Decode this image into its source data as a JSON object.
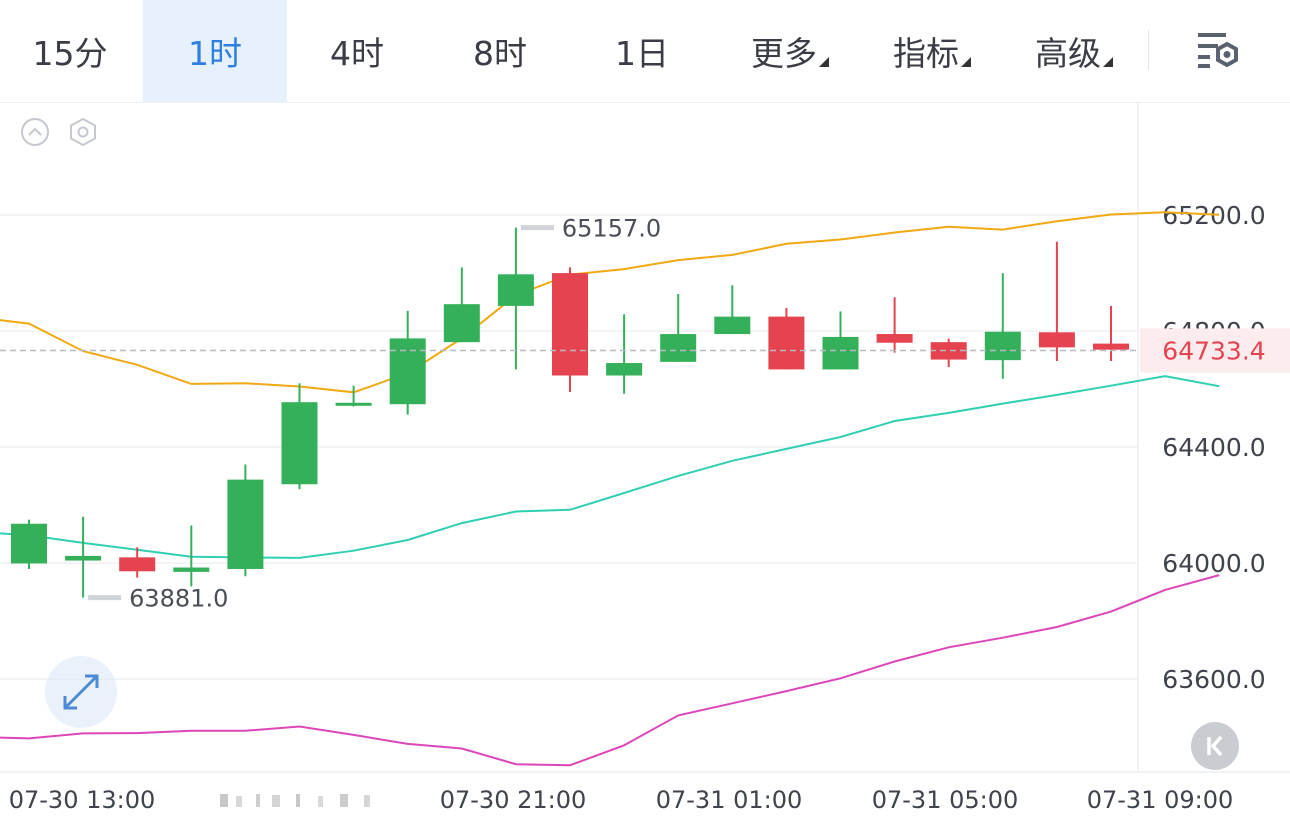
{
  "toolbar": {
    "tabs": [
      {
        "label": "15分"
      },
      {
        "label": "1时",
        "active": true
      },
      {
        "label": "4时"
      },
      {
        "label": "8时"
      },
      {
        "label": "1日"
      },
      {
        "label": "更多",
        "dropdown": true
      },
      {
        "label": "指标",
        "dropdown": true
      },
      {
        "label": "高级",
        "dropdown": true
      }
    ],
    "settings_icon": "chart-settings-icon"
  },
  "colors": {
    "up": "#35b05a",
    "down": "#e4434f",
    "upper_band": "#f0a913",
    "middle_band": "#2fcfb3",
    "lower_band": "#dd46b9",
    "accent": "#2f7fe0",
    "price_tag": "#e4434f"
  },
  "chart_data": {
    "type": "candlestick",
    "y_ticks": [
      "65200.0",
      "64800.0",
      "64400.0",
      "64000.0",
      "63600.0"
    ],
    "x_ticks": [
      "07-30 13:00",
      "07-30 21:00",
      "07-31 01:00",
      "07-31 05:00",
      "07-31 09:00"
    ],
    "ylim": [
      63280,
      65590
    ],
    "grid": true,
    "candles": [
      {
        "o": 63999,
        "h": 64150,
        "l": 63980,
        "c": 64136
      },
      {
        "o": 64009,
        "h": 64160,
        "l": 63881,
        "c": 64025
      },
      {
        "o": 64020,
        "h": 64055,
        "l": 63950,
        "c": 63972
      },
      {
        "o": 63970,
        "h": 64130,
        "l": 63920,
        "c": 63985
      },
      {
        "o": 63980,
        "h": 64340,
        "l": 63955,
        "c": 64288
      },
      {
        "o": 64272,
        "h": 64620,
        "l": 64255,
        "c": 64555
      },
      {
        "o": 64545,
        "h": 64612,
        "l": 64540,
        "c": 64553
      },
      {
        "o": 64548,
        "h": 64870,
        "l": 64512,
        "c": 64775
      },
      {
        "o": 64762,
        "h": 65020,
        "l": 64762,
        "c": 64893
      },
      {
        "o": 64887,
        "h": 65157,
        "l": 64668,
        "c": 64996
      },
      {
        "o": 65000,
        "h": 65020,
        "l": 64590,
        "c": 64647
      },
      {
        "o": 64647,
        "h": 64858,
        "l": 64584,
        "c": 64690
      },
      {
        "o": 64694,
        "h": 64928,
        "l": 64694,
        "c": 64790
      },
      {
        "o": 64790,
        "h": 64958,
        "l": 64790,
        "c": 64850
      },
      {
        "o": 64850,
        "h": 64880,
        "l": 64668,
        "c": 64668
      },
      {
        "o": 64668,
        "h": 64868,
        "l": 64668,
        "c": 64780
      },
      {
        "o": 64790,
        "h": 64917,
        "l": 64726,
        "c": 64760
      },
      {
        "o": 64762,
        "h": 64774,
        "l": 64676,
        "c": 64702
      },
      {
        "o": 64700,
        "h": 65000,
        "l": 64636,
        "c": 64798
      },
      {
        "o": 64796,
        "h": 65108,
        "l": 64697,
        "c": 64744
      },
      {
        "o": 64757,
        "h": 64887,
        "l": 64697,
        "c": 64736
      }
    ],
    "series": [
      {
        "values": [
          64848,
          64826,
          64731,
          64684,
          64618,
          64620,
          64609,
          64589,
          64655,
          64775,
          64924,
          64995,
          65014,
          65045,
          65063,
          65101,
          65116,
          65140,
          65160,
          65150,
          65179,
          65202,
          65210,
          65201
        ]
      },
      {
        "values": [
          64108,
          64096,
          64070,
          64046,
          64022,
          64020,
          64018,
          64043,
          64080,
          64138,
          64178,
          64184,
          64242,
          64301,
          64353,
          64394,
          64435,
          64490,
          64518,
          64550,
          64580,
          64612,
          64645,
          64610
        ]
      },
      {
        "values": [
          63401,
          63396,
          63413,
          63414,
          63422,
          63422,
          63437,
          63408,
          63377,
          63361,
          63307,
          63303,
          63372,
          63475,
          63517,
          63559,
          63603,
          63661,
          63710,
          63743,
          63780,
          63833,
          63908,
          63959
        ]
      }
    ],
    "series_x_offset": -1,
    "last_price": "64733.4",
    "last_price_value": 64733.4,
    "high_marker": {
      "label": "65157.0",
      "index": 9
    },
    "low_marker": {
      "label": "63881.0",
      "index": 1
    }
  }
}
